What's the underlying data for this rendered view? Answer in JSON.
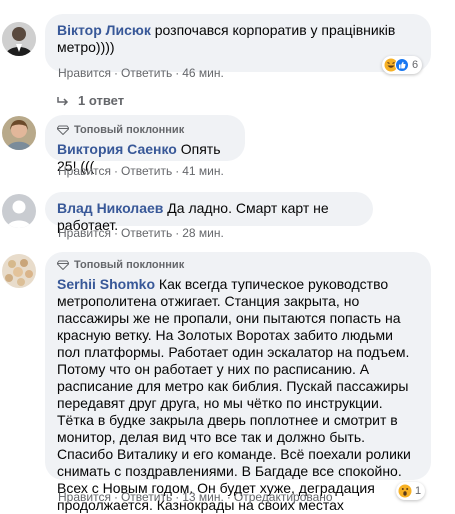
{
  "comments": [
    {
      "author": "Віктор Лисюк",
      "text": "розпочався корпоратив у працівників метро))))",
      "like_label": "Нравится",
      "reply_label": "Ответить",
      "time": "46 мин.",
      "reaction_count": "6"
    },
    {
      "badge": "Топовый поклонник",
      "author": "Виктория Саенко",
      "text": "Опять 25! (((",
      "like_label": "Нравится",
      "reply_label": "Ответить",
      "time": "41 мин."
    },
    {
      "author": "Влад Николаев",
      "text": "Да ладно. Смарт карт не работает.",
      "like_label": "Нравится",
      "reply_label": "Ответить",
      "time": "28 мин."
    },
    {
      "badge": "Топовый поклонник",
      "author": "Serhii Shomko",
      "text": "Как всегда тупическое руководство метрополитена отжигает. Станция закрыта, но пассажиры же не пропали, они пытаются попасть на красную ветку. На Золотых Воротах забито людьми пол платформы. Работает один эскалатор на подъем. Потому что он работает у них по расписанию. А расписание для метро как библия. Пускай пассажиры передавят друг друга, но мы чётко по инструкции. Тётка в будке закрыла дверь поплотнее и смотрит в монитор, делая вид что все так и должно быть. Спасибо Виталику и его команде. Всё поехали ролики снимать с поздравлениями. В Багдаде все спокойно. Всех с Новым годом. Он будет хуже, деградация продолжается. Казнокрады на своих местах",
      "like_label": "Нравится",
      "reply_label": "Ответить",
      "time": "13 мин.",
      "edited_label": "Отредактировано",
      "reaction_count": "1"
    }
  ],
  "replies_link": "1 ответ",
  "separator": "·",
  "colors": {
    "bubble_bg": "#f0f2f5",
    "author": "#385898",
    "meta": "#65676b"
  }
}
